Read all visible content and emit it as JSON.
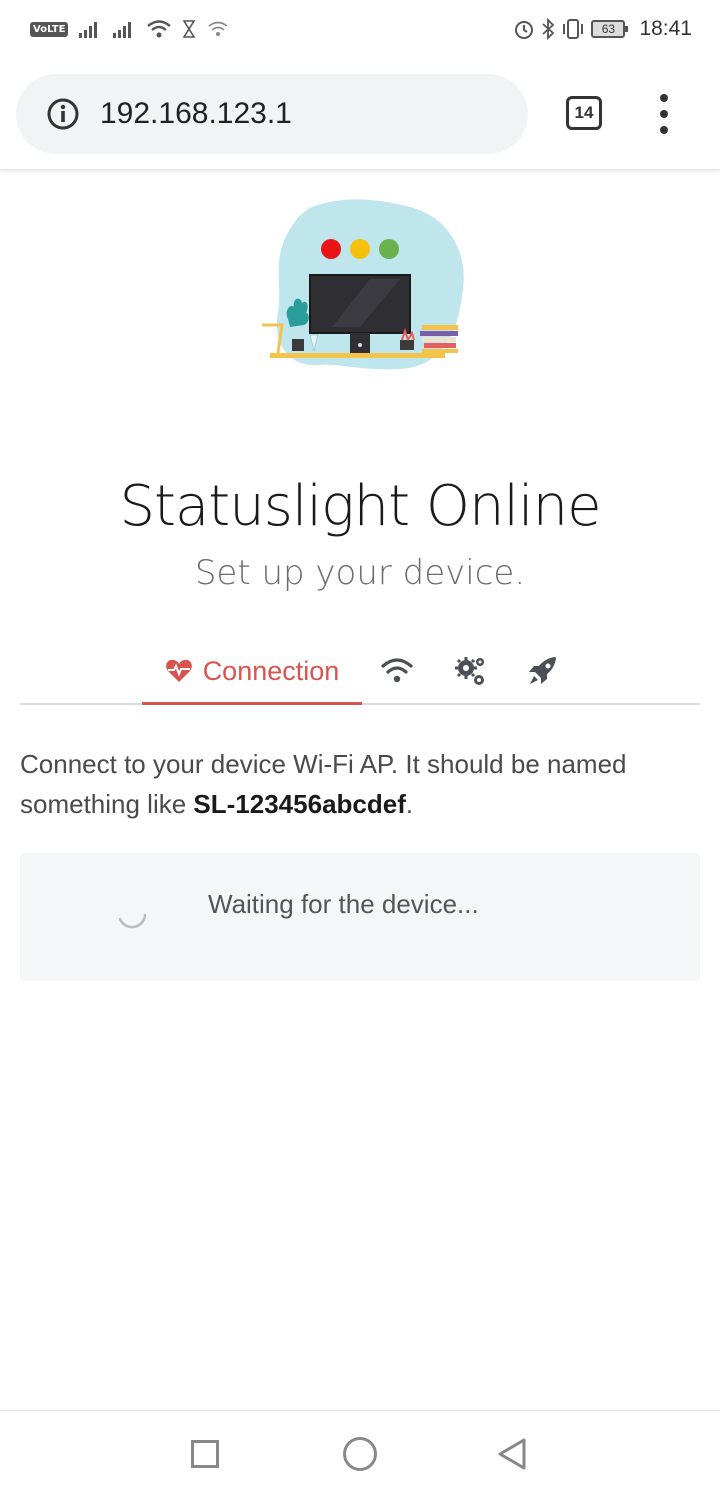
{
  "status_bar": {
    "volte": "VoLTE",
    "battery": "63",
    "time": "18:41"
  },
  "browser": {
    "url": "192.168.123.1",
    "tab_count": "14"
  },
  "page": {
    "title": "Statuslight Online",
    "subtitle": "Set up your device.",
    "steps": [
      {
        "label": "Connection",
        "icon": "heartbeat-icon",
        "active": true
      },
      {
        "icon": "wifi-icon",
        "active": false
      },
      {
        "icon": "gears-icon",
        "active": false
      },
      {
        "icon": "rocket-icon",
        "active": false
      }
    ],
    "instructions_prefix": "Connect to your device Wi-Fi AP. It should be named something like ",
    "instructions_device": "SL-123456abcdef",
    "instructions_suffix": ".",
    "waiting_text": "Waiting for the device..."
  },
  "colors": {
    "accent": "#d9534f",
    "light_red": "#e81416",
    "light_yellow": "#f6c10c",
    "light_green": "#6ab04c",
    "blob": "#bfe6ec"
  }
}
